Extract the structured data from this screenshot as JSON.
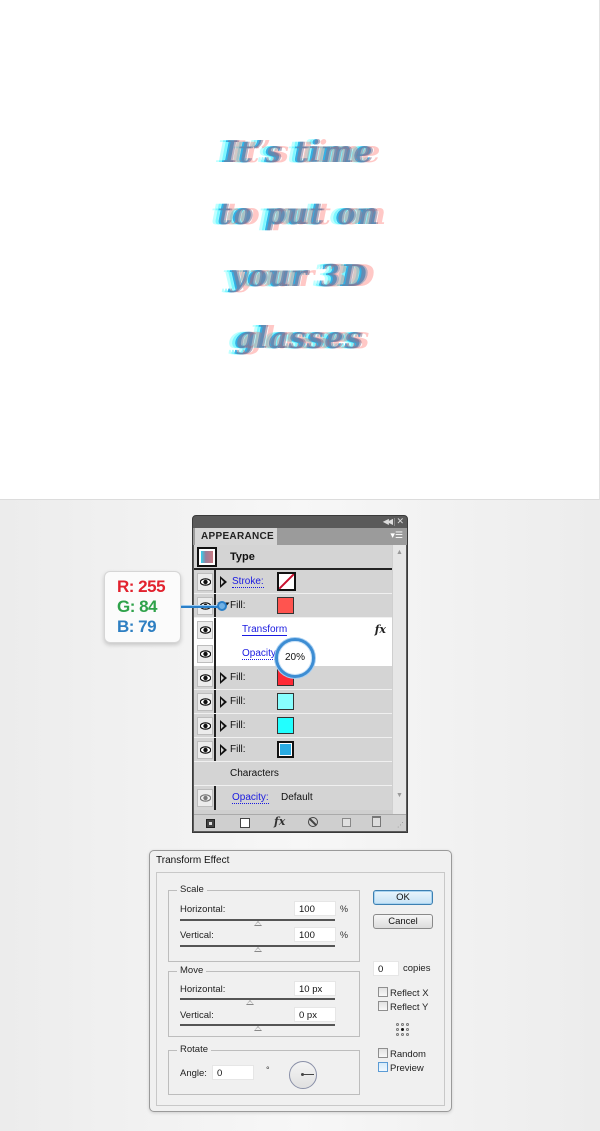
{
  "artwork": {
    "lines": [
      "It’s time",
      "to put on",
      "your 3D",
      "glasses"
    ]
  },
  "callout": {
    "r_label": "R: 255",
    "g_label": "G: 84",
    "b_label": "B: 79"
  },
  "appearance_panel": {
    "collapse_icon": "◀◀",
    "close_icon": "✕",
    "tab_label": "APPEARANCE",
    "menu_icon": "▾☰",
    "header_title": "Type",
    "rows": [
      {
        "type": "stroke",
        "label": "Stroke:",
        "swatch": "none"
      },
      {
        "type": "fill",
        "label": "Fill:",
        "color": "#ff544f"
      },
      {
        "type": "effect",
        "label": "Transform",
        "fx": "fx"
      },
      {
        "type": "opacity",
        "label": "Opacity:",
        "value": "20%"
      },
      {
        "type": "fill",
        "label": "Fill:",
        "color": "#ff2a36"
      },
      {
        "type": "fill",
        "label": "Fill:",
        "color": "#88ffff"
      },
      {
        "type": "fill",
        "label": "Fill:",
        "color": "#22ffff"
      },
      {
        "type": "fill",
        "label": "Fill:",
        "color": "#29abe2"
      }
    ],
    "characters_label": "Characters",
    "opacity_label": "Opacity:",
    "opacity_value": "Default",
    "bottom_fx": "fx",
    "scroll_up": "▲",
    "scroll_down": "▼",
    "grip": "⋰"
  },
  "transform_dialog": {
    "title": "Transform Effect",
    "scale": {
      "label": "Scale",
      "horizontal_label": "Horizontal:",
      "horizontal_value": "100",
      "vertical_label": "Vertical:",
      "vertical_value": "100",
      "unit": "%"
    },
    "move": {
      "label": "Move",
      "horizontal_label": "Horizontal:",
      "horizontal_value": "10 px",
      "vertical_label": "Vertical:",
      "vertical_value": "0 px"
    },
    "rotate": {
      "label": "Rotate",
      "angle_label": "Angle:",
      "angle_value": "0",
      "unit": "°"
    },
    "ok_label": "OK",
    "cancel_label": "Cancel",
    "copies_value": "0",
    "copies_label": "copies",
    "reflect_x_label": "Reflect X",
    "reflect_y_label": "Reflect Y",
    "random_label": "Random",
    "preview_label": "Preview"
  }
}
